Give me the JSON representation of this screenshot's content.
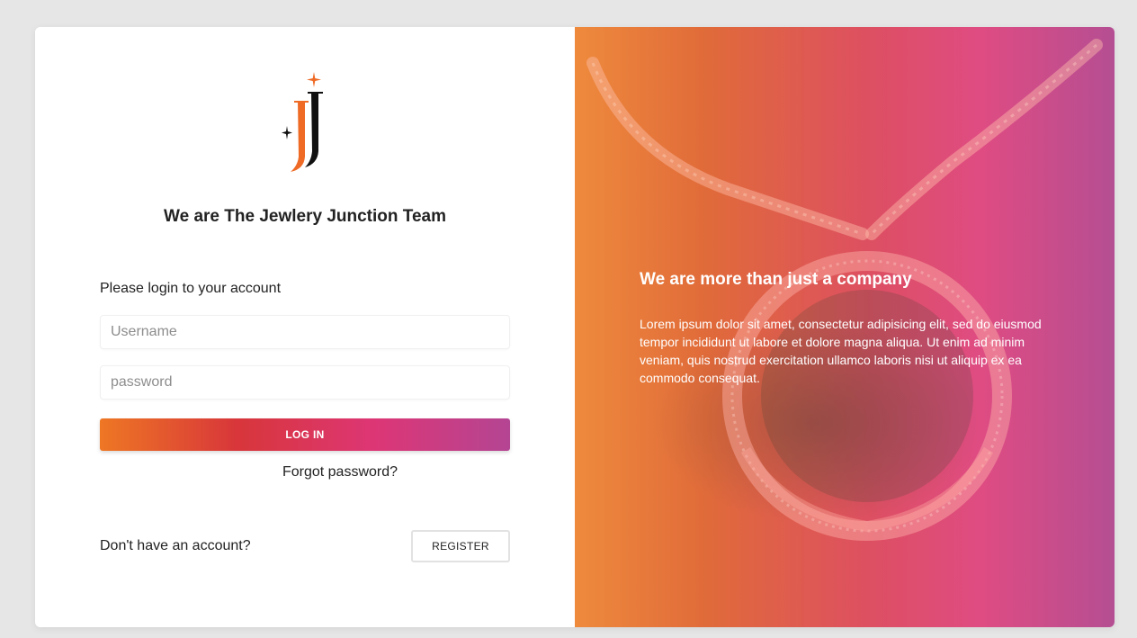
{
  "login_panel": {
    "logo_icon": "jj-star-logo-icon",
    "team_title": "We are The Jewlery Junction Team",
    "login_prompt": "Please login to your account",
    "username_placeholder": "Username",
    "password_placeholder": "password",
    "login_button_label": "LOG IN",
    "forgot_password_link": "Forgot password?",
    "no_account_text": "Don't have an account?",
    "register_button_label": "REGISTER"
  },
  "promo_panel": {
    "title": "We are more than just a company",
    "body": "Lorem ipsum dolor sit amet, consectetur adipisicing elit, sed do eiusmod tempor incididunt ut labore et dolore magna aliqua. Ut enim ad minim veniam, quis nostrud exercitation ullamco laboris nisi ut aliquip ex ea commodo consequat."
  },
  "colors": {
    "gradient": [
      "#ee7724",
      "#d8363a",
      "#dd3675",
      "#b44593"
    ],
    "logo_orange": "#ee6a25",
    "logo_dark": "#111111"
  }
}
